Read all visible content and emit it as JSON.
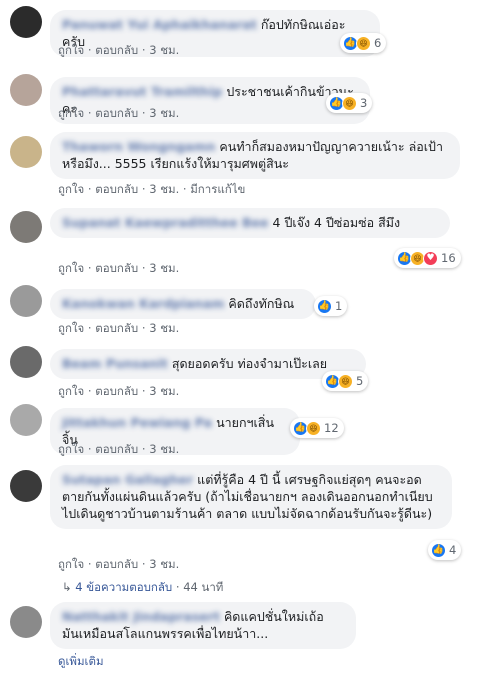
{
  "comments": [
    {
      "name": "Panuwat Yui Aphaikhanarat",
      "text": "ก๊อปทักษิณเอ่อะครับ",
      "like": "ถูกใจ",
      "reply": "ตอบกลับ",
      "time": "3 ชม.",
      "reactions": [
        "like",
        "haha"
      ],
      "count": "6"
    },
    {
      "name": "Phattaravut Tramilthip",
      "text": "ประชาชนเค้ากินข้าวนะคะ",
      "like": "ถูกใจ",
      "reply": "ตอบกลับ",
      "time": "3 ชม.",
      "reactions": [
        "like",
        "haha"
      ],
      "count": "3"
    },
    {
      "name": "Thaworn Wongngamn",
      "text": "คนทำก็สมองหมาปัญญาควายเน้าะ ล่อเป้าหรือมึง... 5555 เรียกแร้งให้มารุมศพตู่สินะ",
      "like": "ถูกใจ",
      "reply": "ตอบกลับ",
      "time": "3 ชม.",
      "edited": "มีการแก้ไข"
    },
    {
      "name": "Supanat Kaewpraditthee Bee",
      "text": "4 ปีเจ๊ง 4 ปีซ่อมซ่อ สีมึง",
      "like": "ถูกใจ",
      "reply": "ตอบกลับ",
      "time": "3 ชม.",
      "reactions": [
        "like",
        "haha",
        "love"
      ],
      "count": "16"
    },
    {
      "name": "Kanokwan Kardpianam",
      "text": "คิดถึงทักษิณ",
      "like": "ถูกใจ",
      "reply": "ตอบกลับ",
      "time": "3 ชม.",
      "reactions": [
        "like"
      ],
      "count": "1"
    },
    {
      "name": "Beam Punsanit",
      "text": "สุดยอดครับ ท่องจำมาเป๊ะเลย",
      "like": "ถูกใจ",
      "reply": "ตอบกลับ",
      "time": "3 ชม.",
      "reactions": [
        "like",
        "haha"
      ],
      "count": "5"
    },
    {
      "name": "Jittakhun Pewiang Pa",
      "text": "นายกฯเสิ่นจิ้น",
      "like": "ถูกใจ",
      "reply": "ตอบกลับ",
      "time": "3 ชม.",
      "reactions": [
        "like",
        "haha"
      ],
      "count": "12"
    },
    {
      "name": "Sutapan Gallagher",
      "text": "แต่ที่รู้คือ 4 ปี นี้ เศรษฐกิจแย่สุดๆ คนจะอดตายกันทั้งแผ่นดินแล้วครับ (ถ้าไม่เชื่อนายกฯ ลองเดินออกนอกทำเนียบไปเดินดูชาวบ้านตามร้านค้า ตลาด แบบไม่จัดฉากด้อนรับกันจะรู้ดีนะ)",
      "like": "ถูกใจ",
      "reply": "ตอบกลับ",
      "time": "3 ชม.",
      "reactions": [
        "like"
      ],
      "count": "4"
    },
    {
      "name": "Natthakit Jindaprasert",
      "text": "คิดแคปชั่นใหม่เถ้อ มันเหมือนสโลแกนพรรคเพื่อไทยน้าา...",
      "more": "ดูเพิ่มเติม"
    }
  ],
  "replies": {
    "label": "4 ข้อความตอบกลับ",
    "time": "44 นาที"
  }
}
